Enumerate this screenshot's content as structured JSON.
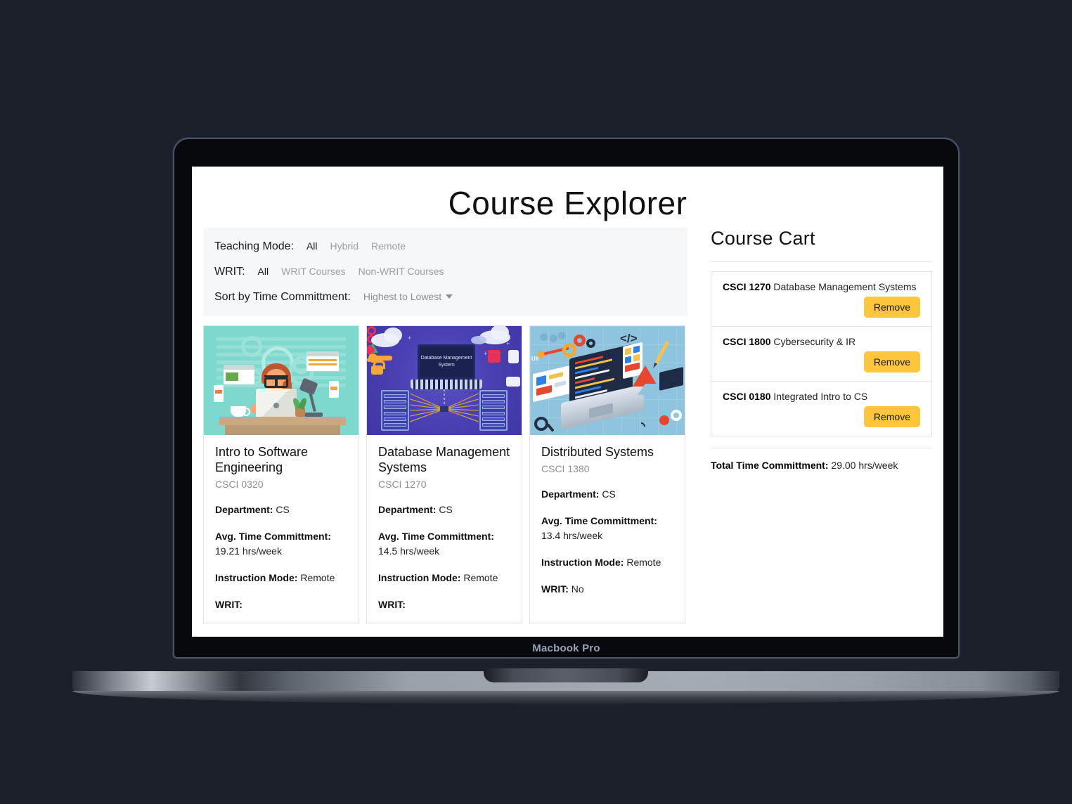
{
  "device": {
    "label": "Macbook Pro"
  },
  "app": {
    "title": "Course Explorer",
    "filters": {
      "teaching_mode": {
        "label": "Teaching Mode:",
        "options": [
          "All",
          "Hybrid",
          "Remote"
        ],
        "selected": "All"
      },
      "writ": {
        "label": "WRIT:",
        "options": [
          "All",
          "WRIT Courses",
          "Non-WRIT Courses"
        ],
        "selected": "All"
      },
      "sort": {
        "label": "Sort by Time Committment:",
        "value": "Highest to Lowest",
        "caret_icon": "chevron-down-icon"
      }
    },
    "courses": [
      {
        "title": "Intro to Software Engineering",
        "code": "CSCI 0320",
        "department_label": "Department:",
        "department": "CS",
        "time_label": "Avg. Time Committment:",
        "time": "19.21 hrs/week",
        "mode_label": "Instruction Mode:",
        "mode": "Remote",
        "writ_label": "WRIT:",
        "writ": "",
        "image_alt": "developer-at-desk-illustration",
        "image_caption": ""
      },
      {
        "title": "Database Management Systems",
        "code": "CSCI 1270",
        "department_label": "Department:",
        "department": "CS",
        "time_label": "Avg. Time Committment:",
        "time": "14.5 hrs/week",
        "mode_label": "Instruction Mode:",
        "mode": "Remote",
        "writ_label": "WRIT:",
        "writ": "",
        "image_alt": "database-management-system-illustration",
        "image_caption": "Database Management System"
      },
      {
        "title": "Distributed Systems",
        "code": "CSCI 1380",
        "department_label": "Department:",
        "department": "CS",
        "time_label": "Avg. Time Committment:",
        "time": "13.4 hrs/week",
        "mode_label": "Instruction Mode:",
        "mode": "Remote",
        "writ_label": "WRIT:",
        "writ": "No",
        "image_alt": "isometric-developer-workspace-illustration",
        "image_caption": ""
      }
    ],
    "cart": {
      "title": "Course Cart",
      "items": [
        {
          "code": "CSCI 1270",
          "name": "Database Management Systems",
          "remove_label": "Remove"
        },
        {
          "code": "CSCI 1800",
          "name": "Cybersecurity & IR",
          "remove_label": "Remove"
        },
        {
          "code": "CSCI 0180",
          "name": "Integrated Intro to CS",
          "remove_label": "Remove"
        }
      ],
      "total_label": "Total Time Committment:",
      "total_value": "29.00 hrs/week"
    },
    "colors": {
      "page_background": "#1b202b",
      "accent_button": "#ffc53d",
      "filter_panel": "#f6f7f9",
      "muted_text": "#8a9096"
    }
  }
}
